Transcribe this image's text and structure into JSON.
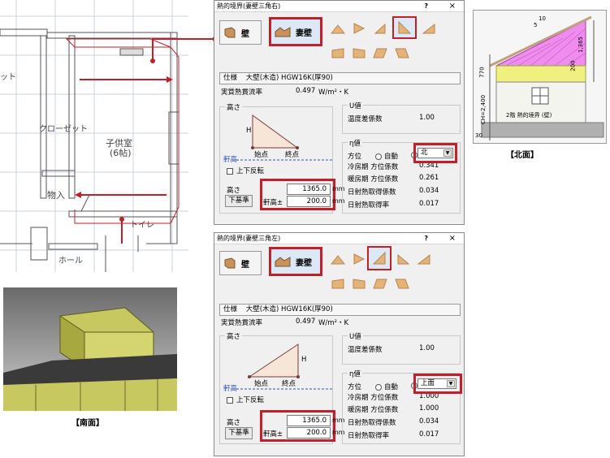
{
  "plan": {
    "labels": [
      "ット",
      "クローゼット",
      "子供室",
      "(6帖)",
      "物入",
      "トイレ",
      "ホール"
    ]
  },
  "dialog_top": {
    "title": "熱的境界(妻壁三角右)",
    "help": "?",
    "close": "×",
    "tab_wall": "壁",
    "tab_gable": "妻壁",
    "spec_label": "仕様",
    "spec_value": "大壁(木造) HGW16K(厚90)",
    "flow_label": "実質熱貫流率",
    "flow_value": "0.497",
    "flow_unit": "W/m²・K",
    "height_group": "高さ",
    "start_label": "始点",
    "end_label": "終点",
    "eave_label": "軒高",
    "h_label": "H",
    "flip_label": "上下反転",
    "height_label": "高さ",
    "height_value": "1365.0",
    "height_unit": "mm",
    "eave_pm_label": "軒高±",
    "eave_value": "200.0",
    "eave_unit": "mm",
    "base_button": "下基準",
    "u_group": "U値",
    "temp_label": "温度差係数",
    "temp_value": "1.00",
    "eta_group": "η値",
    "dir_label": "方位",
    "auto_label": "自動",
    "dir_value": "北",
    "cool_label": "冷房期 方位係数",
    "cool_value": "0.341",
    "heat_label": "暖房期 方位係数",
    "heat_value": "0.261",
    "solar_label": "日射熱取得係数",
    "solar_value": "0.034",
    "gain_label": "日射熱取得率",
    "gain_value": "0.017"
  },
  "dialog_bottom": {
    "title": "熱的境界(妻壁三角左)",
    "help": "?",
    "close": "×",
    "tab_wall": "壁",
    "tab_gable": "妻壁",
    "spec_label": "仕様",
    "spec_value": "大壁(木造) HGW16K(厚90)",
    "flow_label": "実質熱貫流率",
    "flow_value": "0.497",
    "flow_unit": "W/m²・K",
    "height_group": "高さ",
    "start_label": "始点",
    "end_label": "終点",
    "eave_label": "軒高",
    "h_label": "H",
    "flip_label": "上下反転",
    "height_label": "高さ",
    "height_value": "1365.0",
    "height_unit": "mm",
    "eave_pm_label": "軒高±",
    "eave_value": "200.0",
    "eave_unit": "mm",
    "base_button": "下基準",
    "u_group": "U値",
    "temp_label": "温度差係数",
    "temp_value": "1.00",
    "eta_group": "η値",
    "dir_label": "方位",
    "auto_label": "自動",
    "dir_value": "上面",
    "cool_label": "冷房期 方位係数",
    "cool_value": "1.000",
    "heat_label": "暖房期 方位係数",
    "heat_value": "1.000",
    "solar_label": "日射熱取得係数",
    "solar_value": "0.034",
    "gain_label": "日射熱取得率",
    "gain_value": "0.017"
  },
  "north": {
    "caption": "【北面】",
    "dims": [
      "10",
      "5",
      "1,365",
      "200",
      "770",
      "CH=2,400",
      "30"
    ],
    "label": "2階 熱的境界 (壁)"
  },
  "south": {
    "caption": "【南面】"
  },
  "colors": {
    "accent_red": "#c0202a",
    "pink": "#f08cf0",
    "yellow": "#f0f080",
    "wall_3d": "#c8c860"
  }
}
